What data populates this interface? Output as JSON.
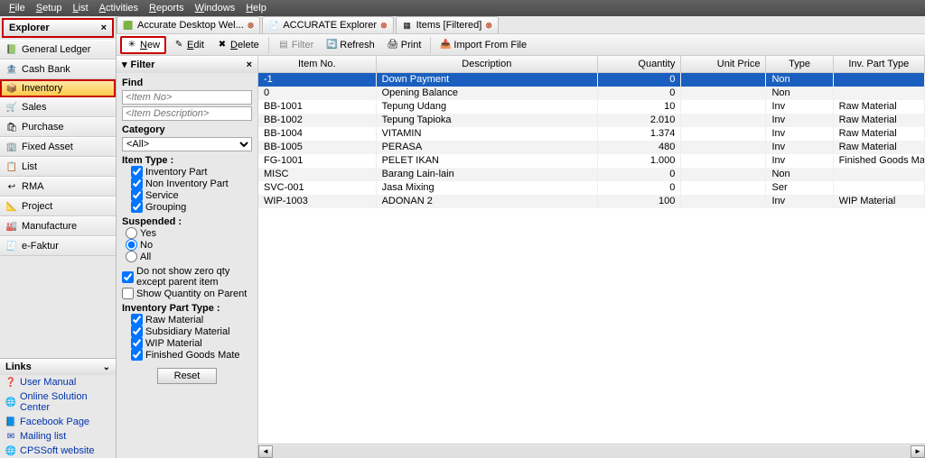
{
  "menu": [
    "File",
    "Setup",
    "List",
    "Activities",
    "Reports",
    "Windows",
    "Help"
  ],
  "explorer_title": "Explorer",
  "nav": [
    {
      "id": "general-ledger",
      "label": "General Ledger",
      "ico": "📗"
    },
    {
      "id": "cash-bank",
      "label": "Cash Bank",
      "ico": "🏦"
    },
    {
      "id": "inventory",
      "label": "Inventory",
      "ico": "📦",
      "sel": true
    },
    {
      "id": "sales",
      "label": "Sales",
      "ico": "🛒"
    },
    {
      "id": "purchase",
      "label": "Purchase",
      "ico": "🛍"
    },
    {
      "id": "fixed-asset",
      "label": "Fixed Asset",
      "ico": "🏢"
    },
    {
      "id": "list",
      "label": "List",
      "ico": "📋"
    },
    {
      "id": "rma",
      "label": "RMA",
      "ico": "↩"
    },
    {
      "id": "project",
      "label": "Project",
      "ico": "📐"
    },
    {
      "id": "manufacture",
      "label": "Manufacture",
      "ico": "🏭"
    },
    {
      "id": "e-faktur",
      "label": "e-Faktur",
      "ico": "🧾"
    }
  ],
  "links_title": "Links",
  "links": [
    {
      "id": "user-manual",
      "label": "User Manual",
      "ico": "❓"
    },
    {
      "id": "online-solution",
      "label": "Online Solution Center",
      "ico": "🌐"
    },
    {
      "id": "facebook",
      "label": "Facebook Page",
      "ico": "📘"
    },
    {
      "id": "mailing-list",
      "label": "Mailing list",
      "ico": "✉"
    },
    {
      "id": "cpssoft",
      "label": "CPSSoft website",
      "ico": "🌐"
    }
  ],
  "tabs": [
    {
      "id": "welcome",
      "label": "Accurate Desktop Wel...",
      "ico": "🟩"
    },
    {
      "id": "explorer",
      "label": "ACCURATE Explorer",
      "ico": "📄"
    },
    {
      "id": "items",
      "label": "Items [Filtered]",
      "ico": "▦"
    }
  ],
  "toolbar": {
    "new": "New",
    "edit": "Edit",
    "delete": "Delete",
    "filter": "Filter",
    "refresh": "Refresh",
    "print": "Print",
    "import": "Import From File"
  },
  "filter": {
    "title": "Filter",
    "find": "Find",
    "item_no_ph": "<Item No>",
    "item_desc_ph": "<Item Description>",
    "category": "Category",
    "category_val": "<All>",
    "item_type": "Item Type :",
    "it": [
      "Inventory Part",
      "Non Inventory Part",
      "Service",
      "Grouping"
    ],
    "suspended": "Suspended :",
    "susp": [
      "Yes",
      "No",
      "All"
    ],
    "donotshow": "Do not show zero qty except parent item",
    "showqty": "Show Quantity on Parent",
    "inv_part_type": "Inventory Part Type :",
    "ipt": [
      "Raw Material",
      "Subsidiary Material",
      "WIP Material",
      "Finished Goods Mate"
    ],
    "reset": "Reset"
  },
  "columns": [
    "Item No.",
    "Description",
    "Quantity",
    "Unit Price",
    "Type",
    "Inv. Part Type"
  ],
  "rows": [
    {
      "no": "-1",
      "desc": "Down Payment",
      "qty": "0",
      "price": "",
      "type": "Non",
      "pt": "",
      "sel": true
    },
    {
      "no": "0",
      "desc": "Opening Balance",
      "qty": "0",
      "price": "",
      "type": "Non",
      "pt": ""
    },
    {
      "no": "BB-1001",
      "desc": "Tepung Udang",
      "qty": "10",
      "price": "",
      "type": "Inv",
      "pt": "Raw Material"
    },
    {
      "no": "BB-1002",
      "desc": "Tepung Tapioka",
      "qty": "2.010",
      "price": "",
      "type": "Inv",
      "pt": "Raw Material"
    },
    {
      "no": "BB-1004",
      "desc": "VITAMIN",
      "qty": "1.374",
      "price": "",
      "type": "Inv",
      "pt": "Raw Material"
    },
    {
      "no": "BB-1005",
      "desc": "PERASA",
      "qty": "480",
      "price": "",
      "type": "Inv",
      "pt": "Raw Material"
    },
    {
      "no": "FG-1001",
      "desc": "PELET IKAN",
      "qty": "1.000",
      "price": "",
      "type": "Inv",
      "pt": "Finished Goods Material"
    },
    {
      "no": "MISC",
      "desc": "Barang Lain-lain",
      "qty": "0",
      "price": "",
      "type": "Non",
      "pt": ""
    },
    {
      "no": "SVC-001",
      "desc": "Jasa Mixing",
      "qty": "0",
      "price": "",
      "type": "Ser",
      "pt": ""
    },
    {
      "no": "WIP-1003",
      "desc": "ADONAN 2",
      "qty": "100",
      "price": "",
      "type": "Inv",
      "pt": "WIP Material"
    }
  ]
}
